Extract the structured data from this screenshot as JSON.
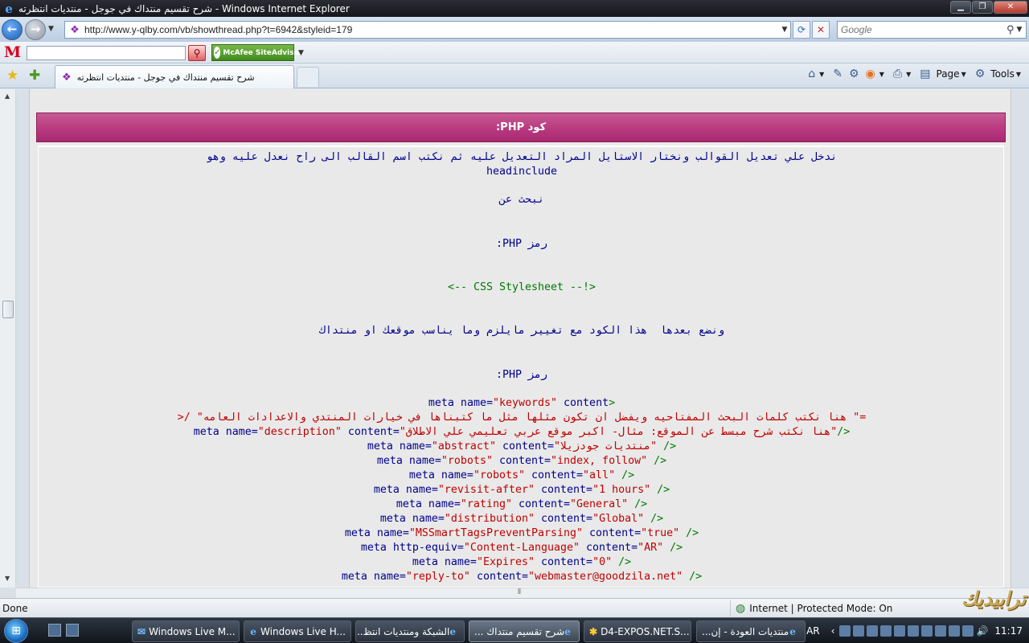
{
  "window": {
    "title": "شرح تقسيم منتداك في جوجل - منتديات انتظرته - Windows Internet Explorer",
    "min": "▁",
    "max": "❐",
    "close": "✕"
  },
  "nav": {
    "url": "http://www.y-qlby.com/vb/showthread.php?t=6942&styleid=179",
    "search_placeholder": "Google"
  },
  "toolbar": {
    "logo": "M",
    "siteadvisor_label": "McAfee SiteAdvisor"
  },
  "tabs": {
    "active_label": "شرح تقسيم منتداك في جوجل - منتديات انتظرته"
  },
  "command_bar": {
    "page_label": "Page",
    "tools_label": "Tools"
  },
  "content": {
    "code_header": "كود PHP:",
    "intro_line1": "ندخل علي تعديل القوالب ونختار الاستايل المراد التعديل عليه ثم نكتب اسم القالب الى راح نعدل عليه وهو",
    "intro_line2": "headinclude",
    "search_for": "نبحث عن",
    "php_symbol_1": "رمز PHP:",
    "css_comment": "<-- CSS Stylesheet --!>",
    "put_after": "ونضع بعدها  هذا الكود مع تغيير مايلزم وما يناسب موقعك او منتداك",
    "php_symbol_2": "رمز PHP:",
    "meta_lines": [
      {
        "pre": "meta name=",
        "a": "\"keywords\"",
        "mid": " content",
        "end": ">"
      },
      {
        "text": "=\" هنا نكتب كلمات البحث المفتاحيه ويفضل ان تكون مثلها مثل ما كتبناها في خيارات المنتدي والاعدادات العامه\" /<"
      },
      {
        "pre": "meta name=",
        "a": "\"description\"",
        "mid": " content=",
        "b": "\"هنا نكتب شرح مبسط عن الموقع: مثال- اكبر موقع عربي تعليمي علي الاطلاق\"",
        "end": "/>"
      },
      {
        "pre": "meta name=",
        "a": "\"abstract\"",
        "mid": " content=",
        "b": "\"منتديات جودزيلا\"",
        "end": " />"
      },
      {
        "pre": "meta name=",
        "a": "\"robots\"",
        "mid": " content=",
        "b": "\"index, follow\"",
        "end": " />"
      },
      {
        "pre": "meta name=",
        "a": "\"robots\"",
        "mid": " content=",
        "b": "\"all\"",
        "end": " />"
      },
      {
        "pre": "meta name=",
        "a": "\"revisit-after\"",
        "mid": " content=",
        "b": "\"1 hours\"",
        "end": " />"
      },
      {
        "pre": "meta name=",
        "a": "\"rating\"",
        "mid": " content=",
        "b": "\"General\"",
        "end": " />"
      },
      {
        "pre": "meta name=",
        "a": "\"distribution\"",
        "mid": " content=",
        "b": "\"Global\"",
        "end": " />"
      },
      {
        "pre": "meta name=",
        "a": "\"MSSmartTagsPreventParsing\"",
        "mid": " content=",
        "b": "\"true\"",
        "end": " />"
      },
      {
        "pre": "meta http-equiv=",
        "a": "\"Content-Language\"",
        "mid": " content=",
        "b": "\"AR\"",
        "end": " />"
      },
      {
        "pre": "meta name=",
        "a": "\"Expires\"",
        "mid": " content=",
        "b": "\"0\"",
        "end": " />"
      },
      {
        "pre": "meta name=",
        "a": "\"reply-to\"",
        "mid": " content=",
        "b": "\"webmaster@goodzila.net\"",
        "end": " />"
      }
    ]
  },
  "status": {
    "text": "Done",
    "zone": "Internet | Protected Mode: On",
    "watermark": "ترابيديك"
  },
  "taskbar": {
    "items": [
      "Windows Live M...",
      "Windows Live H...",
      "الشبكة ومنتديات انتظ...",
      "شرح تقسيم منتداك ...",
      "D4-EXPOS.NET.S...",
      "منتديات العودة - إن..."
    ],
    "lang": "AR",
    "clock": "11:17"
  }
}
